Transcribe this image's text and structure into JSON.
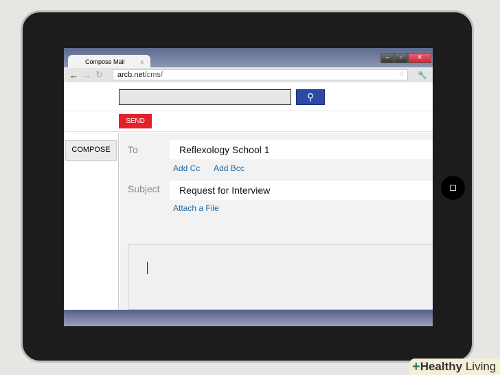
{
  "browser": {
    "tab_title": "Compose Mail",
    "tab_close": "x",
    "url_domain": "arcb.net",
    "url_path": "/cms/"
  },
  "toolbar": {
    "send_label": "SEND"
  },
  "sidebar": {
    "compose_label": "COMPOSE"
  },
  "form": {
    "to_label": "To",
    "to_value": "Reflexology School 1",
    "add_cc": "Add Cc",
    "add_bcc": "Add Bcc",
    "subject_label": "Subject",
    "subject_value": "Request for Interview",
    "attach": "Attach a File"
  },
  "watermark": {
    "brand_bold": "Healthy",
    "brand_light": " Living"
  }
}
